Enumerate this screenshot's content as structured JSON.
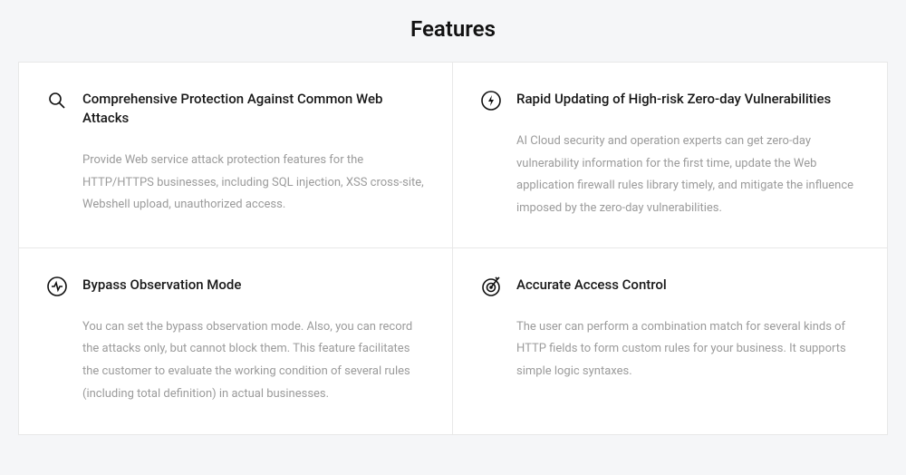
{
  "page": {
    "title": "Features"
  },
  "features": [
    {
      "icon": "wrench-refresh-icon",
      "title": "Comprehensive Protection Against Common Web Attacks",
      "description": "Provide Web service attack protection features for the HTTP/HTTPS businesses, including SQL injection, XSS cross-site, Webshell upload, unauthorized access."
    },
    {
      "icon": "lightning-circle-icon",
      "title": "Rapid Updating of High-risk Zero-day Vulnerabilities",
      "description": "AI Cloud security and operation experts can get zero-day vulnerability information for the first time, update the Web application firewall rules library timely, and mitigate the influence imposed by the zero-day vulnerabilities."
    },
    {
      "icon": "activity-circle-icon",
      "title": "Bypass Observation Mode",
      "description": "You can set the bypass observation mode. Also, you can record the attacks only, but cannot block them. This feature facilitates the customer to evaluate the working condition of several rules (including total definition) in actual businesses."
    },
    {
      "icon": "target-arrow-icon",
      "title": "Accurate Access Control",
      "description": "The user can perform a combination match for several kinds of HTTP fields to form custom rules for your business. It supports simple logic syntaxes."
    }
  ]
}
